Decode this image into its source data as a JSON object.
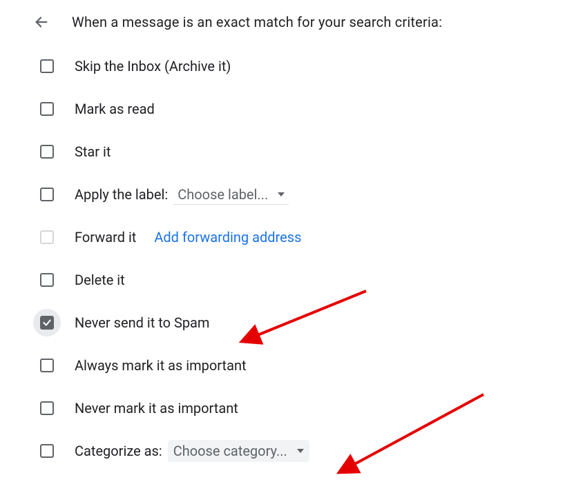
{
  "header": {
    "title": "When a message is an exact match for your search criteria:"
  },
  "options": {
    "skip_inbox": "Skip the Inbox (Archive it)",
    "mark_read": "Mark as read",
    "star": "Star it",
    "apply_label": "Apply the label:",
    "apply_label_select": "Choose label...",
    "forward": "Forward it",
    "forward_link": "Add forwarding address",
    "delete": "Delete it",
    "never_spam": "Never send it to Spam",
    "always_important": "Always mark it as important",
    "never_important": "Never mark it as important",
    "categorize": "Categorize as:",
    "categorize_select": "Choose category..."
  }
}
